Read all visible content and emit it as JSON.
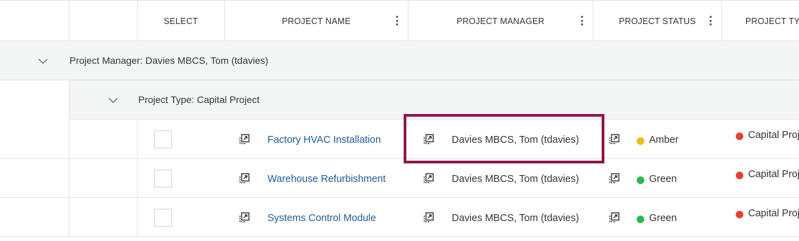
{
  "header": {
    "columns": [
      {
        "label": ""
      },
      {
        "label": ""
      },
      {
        "label": "SELECT"
      },
      {
        "label": "PROJECT NAME"
      },
      {
        "label": "PROJECT MANAGER"
      },
      {
        "label": "PROJECT STATUS"
      },
      {
        "label": "PROJECT TYI"
      }
    ]
  },
  "group_manager": {
    "label": "Project Manager: Davies MBCS, Tom (tdavies)"
  },
  "group_type": {
    "label": "Project Type: Capital Project"
  },
  "rows": [
    {
      "name": "Factory HVAC Installation",
      "manager": "Davies MBCS, Tom (tdavies)",
      "status": "Amber",
      "status_color": "#f2b90f",
      "type": "Capital Proj",
      "type_color": "#e8402a"
    },
    {
      "name": "Warehouse Refurbishment",
      "manager": "Davies MBCS, Tom (tdavies)",
      "status": "Green",
      "status_color": "#2bb84c",
      "type": "Capital Proj",
      "type_color": "#e8402a"
    },
    {
      "name": "Systems Control Module",
      "manager": "Davies MBCS, Tom (tdavies)",
      "status": "Green",
      "status_color": "#2bb84c",
      "type": "Capital Proj",
      "type_color": "#e8402a"
    }
  ],
  "colors": {
    "link": "#1f5a99",
    "highlight_border": "#8b1a4a",
    "group_bg": "#f4f5f5"
  }
}
